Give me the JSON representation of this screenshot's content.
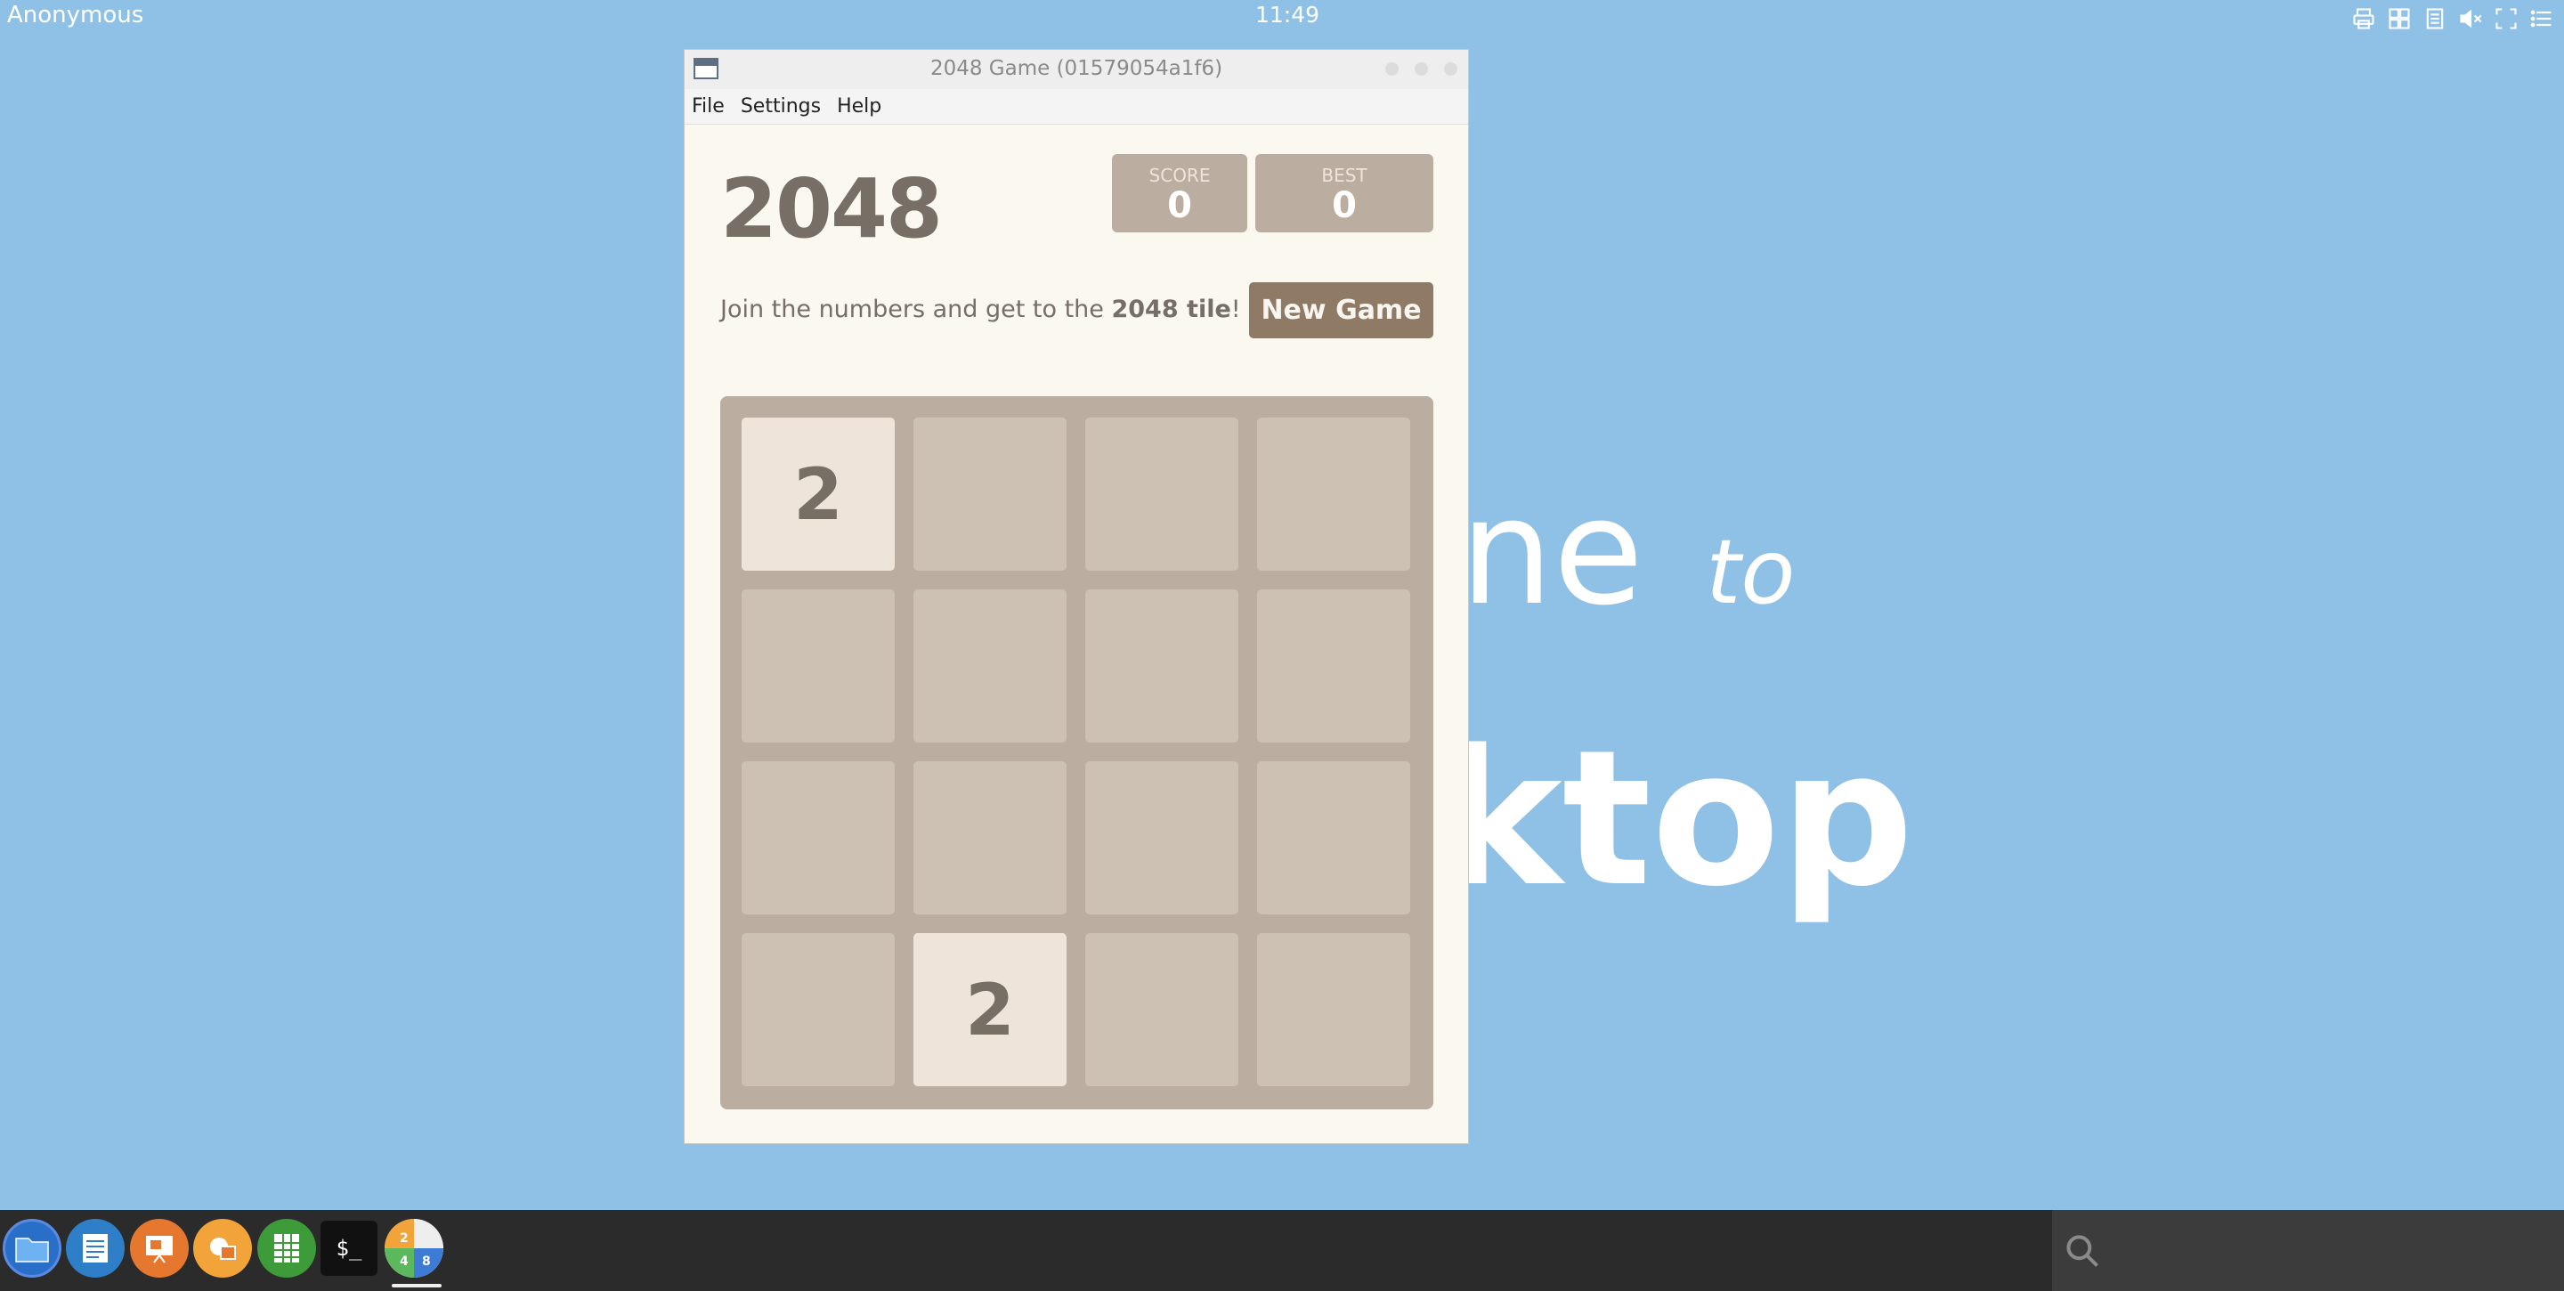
{
  "topbar": {
    "user": "Anonymous",
    "clock": "11:49",
    "tray_icons": [
      "printer-icon",
      "window-switcher-icon",
      "document-icon",
      "volume-muted-icon",
      "fullscreen-icon",
      "menu-icon"
    ]
  },
  "wallpaper": {
    "line1": "ne",
    "line1_small": "to",
    "line2": "ktop"
  },
  "window": {
    "title": "2048 Game (01579054a1f6)",
    "menu": [
      "File",
      "Settings",
      "Help"
    ]
  },
  "game": {
    "title": "2048",
    "score_label": "SCORE",
    "score": "0",
    "best_label": "BEST",
    "best": "0",
    "intro_prefix": "Join the numbers and get to the ",
    "intro_bold": "2048 tile",
    "intro_suffix": "!",
    "new_game_label": "New Game",
    "grid": [
      [
        2,
        0,
        0,
        0
      ],
      [
        0,
        0,
        0,
        0
      ],
      [
        0,
        0,
        0,
        0
      ],
      [
        0,
        2,
        0,
        0
      ]
    ]
  },
  "taskbar": {
    "apps": [
      "files-icon",
      "writer-icon",
      "impress-icon",
      "draw-icon",
      "calc-icon",
      "terminal-icon",
      "game-2048-icon"
    ],
    "terminal_glyph": "$_",
    "game_icon_digits": [
      "2",
      "4",
      "8"
    ]
  },
  "colors": {
    "desktop": "#8fc1e7",
    "board": "#bbada0",
    "empty_cell": "#cdc1b4",
    "tile_2": "#eee4da",
    "button": "#8f7a66"
  }
}
